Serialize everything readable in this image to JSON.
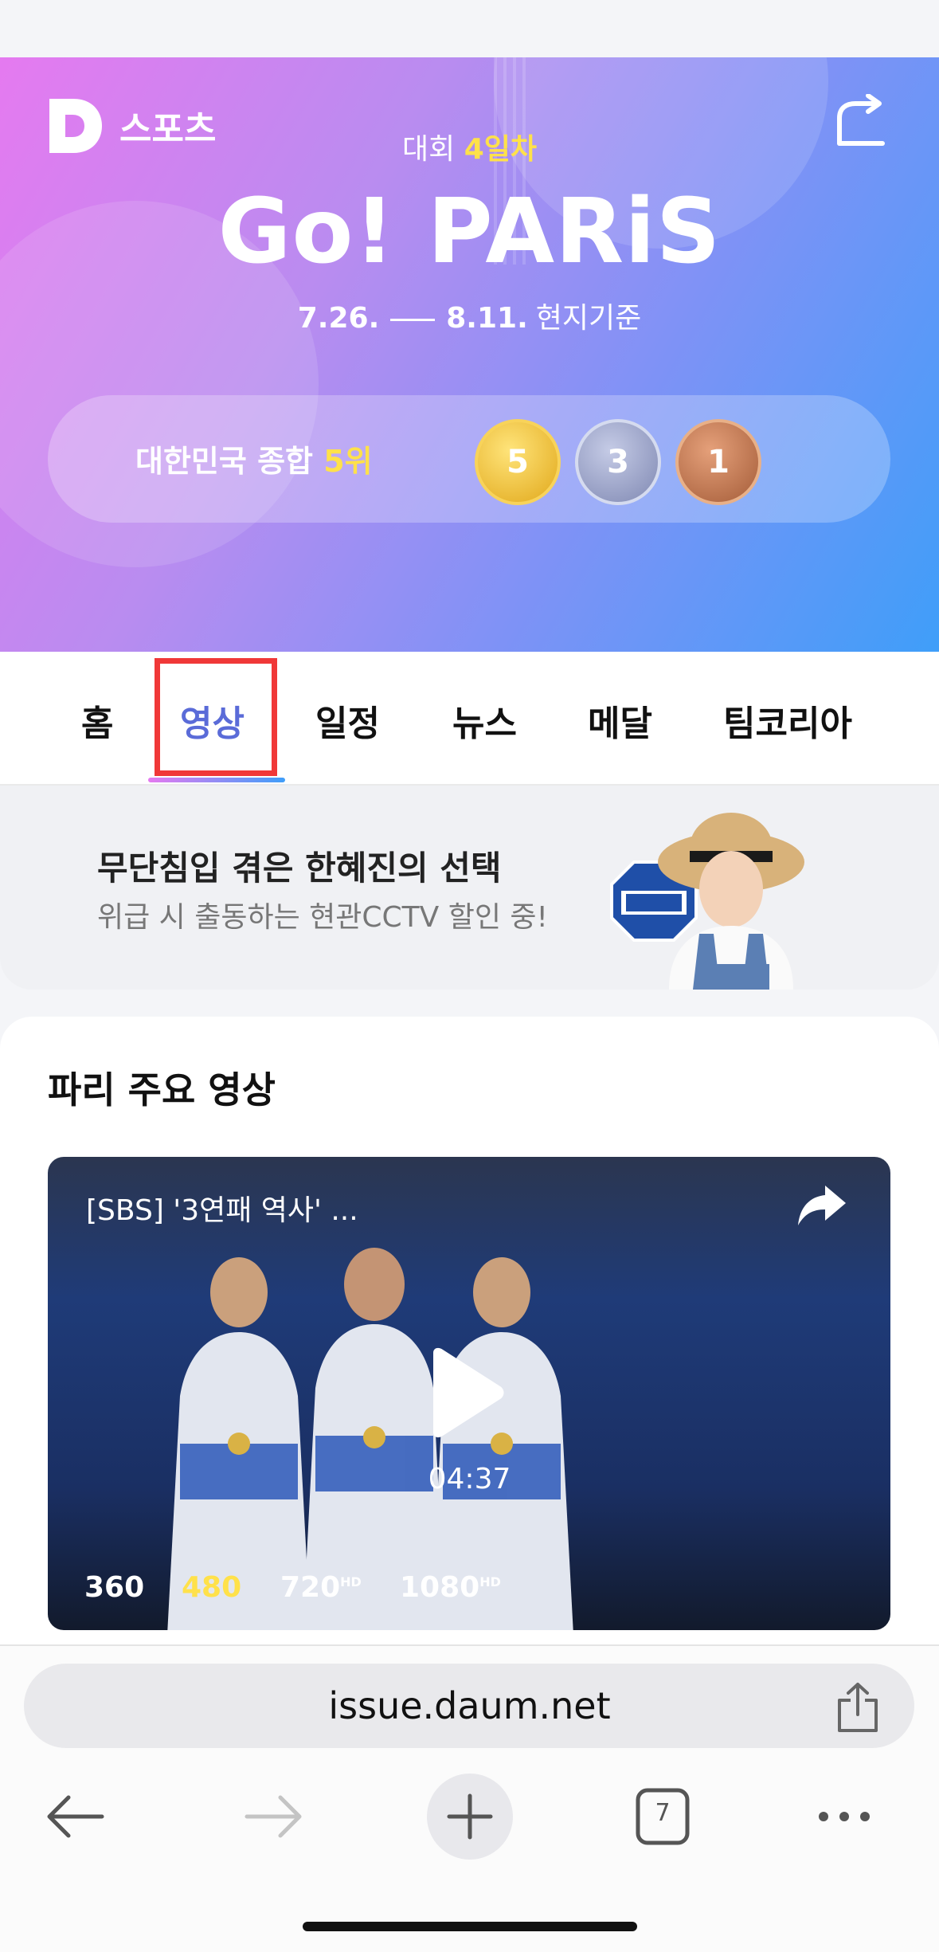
{
  "header": {
    "brand_label": "스포츠",
    "day_prefix": "대회 ",
    "day_highlight": "4일차",
    "title": "Go! PARiS",
    "date_start": "7.26.",
    "date_end": "8.11.",
    "date_suffix": "현지기준"
  },
  "ranking": {
    "label_prefix": "대한민국 종합 ",
    "rank": "5위",
    "gold": "5",
    "silver": "3",
    "bronze": "1"
  },
  "tabs": [
    {
      "label": "홈"
    },
    {
      "label": "영상"
    },
    {
      "label": "일정"
    },
    {
      "label": "뉴스"
    },
    {
      "label": "메달"
    },
    {
      "label": "팀코리아"
    }
  ],
  "ad": {
    "title": "무단침입 겪은 한혜진의 선택",
    "subtitle": "위급 시 출동하는 현관CCTV 할인 중!"
  },
  "section": {
    "title": "파리 주요 영상"
  },
  "video": {
    "title": "[SBS] '3연패 역사' ...",
    "duration": "04:37",
    "qualities": [
      {
        "label": "360",
        "hd": ""
      },
      {
        "label": "480",
        "hd": ""
      },
      {
        "label": "720",
        "hd": "HD"
      },
      {
        "label": "1080",
        "hd": "HD"
      }
    ]
  },
  "browser": {
    "url": "issue.daum.net",
    "tab_count": "7"
  },
  "colors": {
    "accent": "#ffe14a",
    "active_tab": "#5a6bd8",
    "highlight_box": "#f03838"
  }
}
